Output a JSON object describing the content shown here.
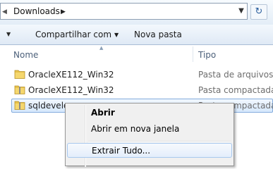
{
  "address_bar": {
    "path": "Downloads",
    "refresh_icon": "refresh-icon"
  },
  "toolbar": {
    "share_label": "Compartilhar com",
    "new_folder_label": "Nova pasta"
  },
  "columns": {
    "name": "Nome",
    "type": "Tipo"
  },
  "files": [
    {
      "name": "OracleXE112_Win32",
      "type": "Pasta de arquivos",
      "icon": "folder-icon"
    },
    {
      "name": "OracleXE112_Win32",
      "type": "Pasta compactada",
      "icon": "zip-folder-icon"
    },
    {
      "name": "sqldevelop",
      "type": "Pasta compactada",
      "icon": "zip-folder-icon",
      "selected": true
    }
  ],
  "context_menu": {
    "items": [
      {
        "label": "Abrir",
        "bold": true
      },
      {
        "label": "Abrir em nova janela"
      },
      {
        "label": "Extrair Tudo...",
        "hover": true
      }
    ]
  },
  "colors": {
    "selection_border": "#84acdd",
    "toolbar_bg": "#dfe9f5"
  }
}
